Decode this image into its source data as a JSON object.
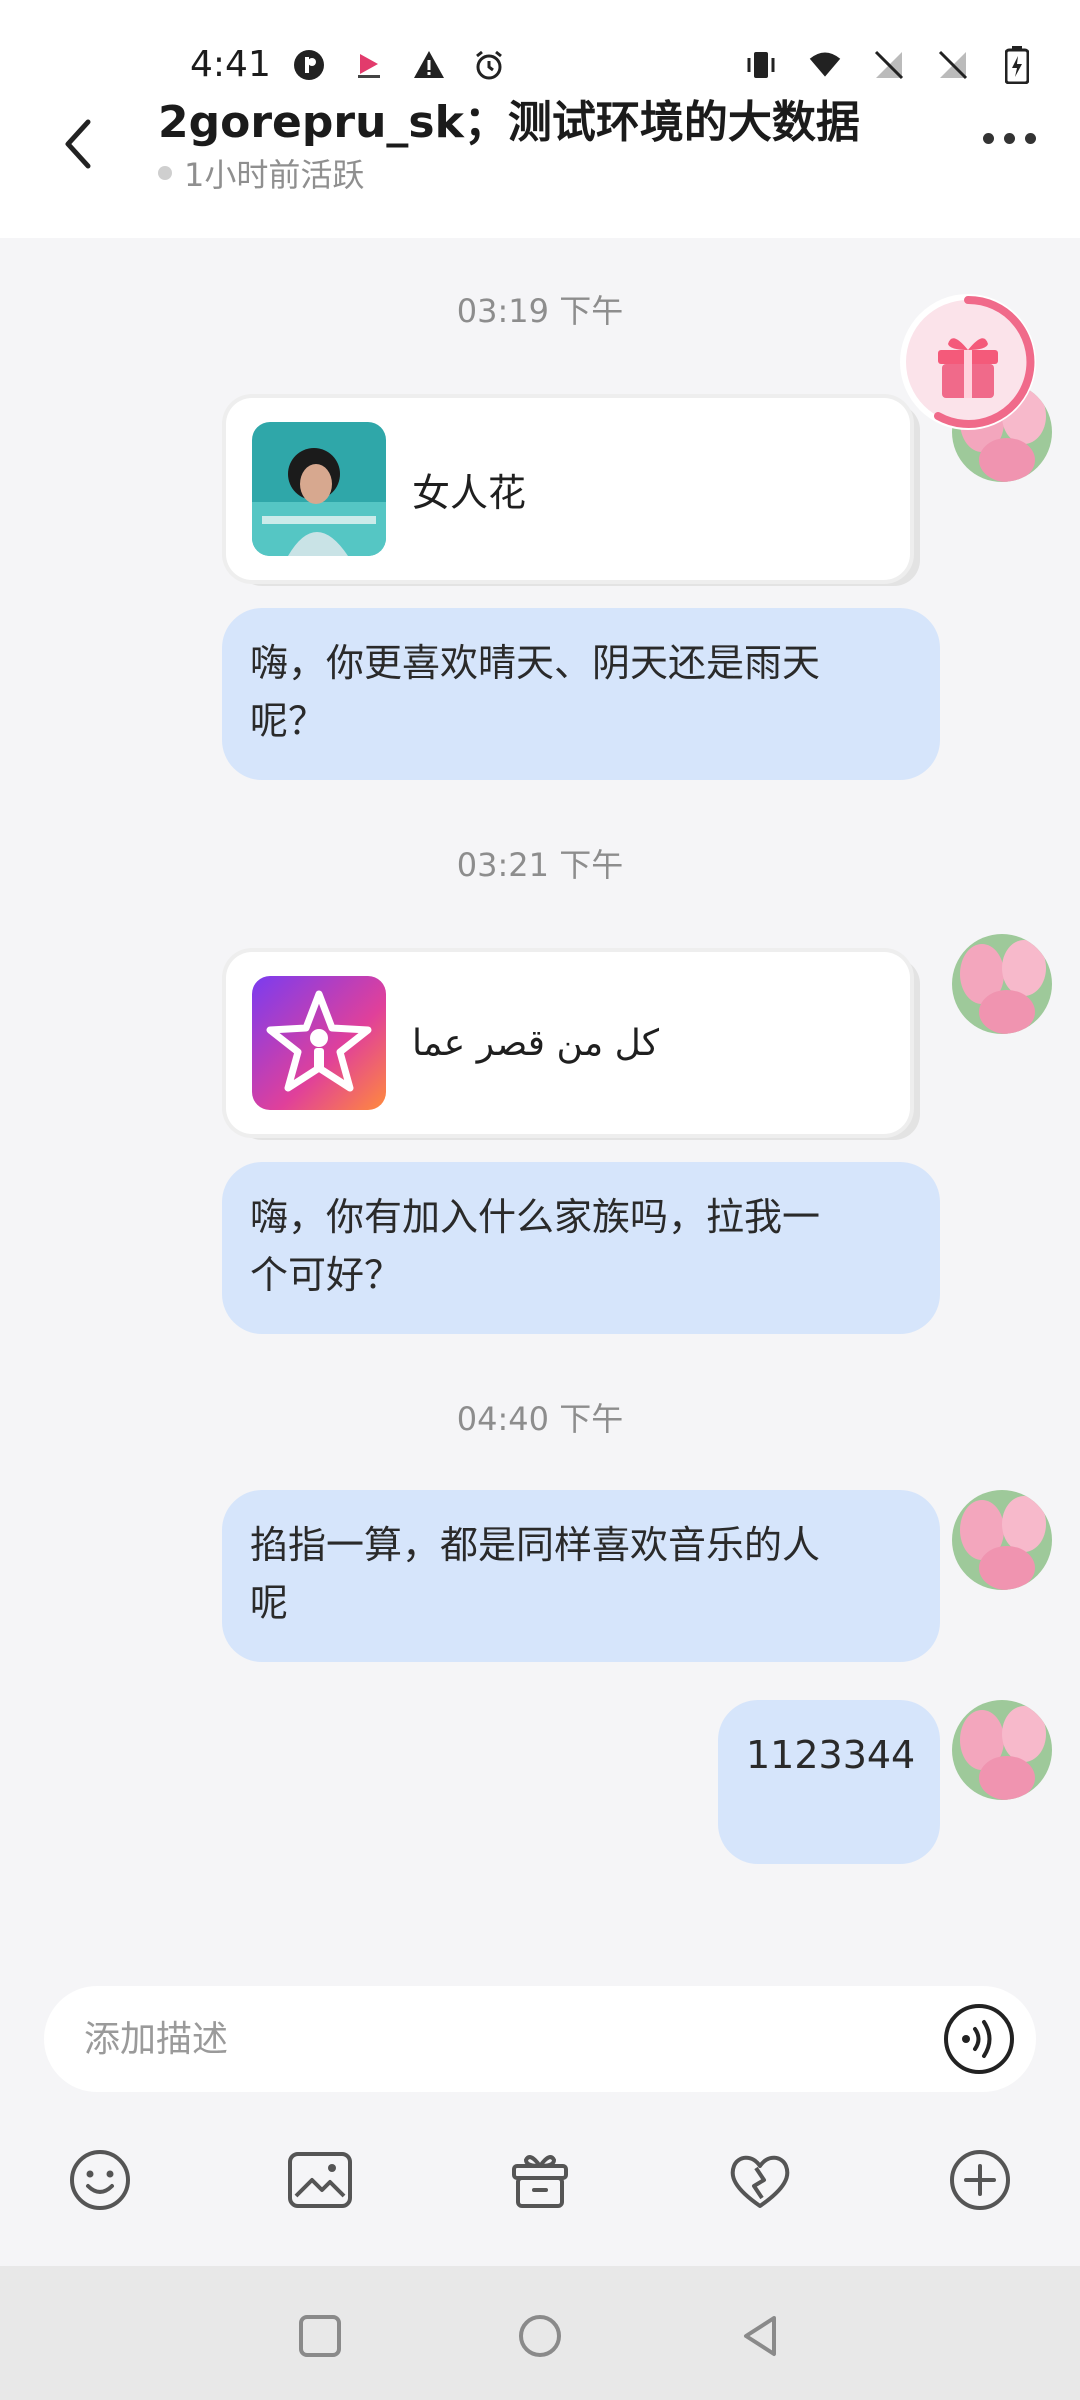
{
  "status_bar": {
    "time": "4:41"
  },
  "header": {
    "title": "2gorepru_sk；测试环境的大数据",
    "subtitle": "1小时前活跃"
  },
  "messages": [
    {
      "type": "timestamp",
      "text": "03:19 下午"
    },
    {
      "type": "card",
      "title": "女人花",
      "thumb": "album-cover"
    },
    {
      "type": "text",
      "text_lines": [
        "嗨，你更喜欢晴天、阴天还是雨天",
        "呢？"
      ]
    },
    {
      "type": "timestamp",
      "text": "03:21 下午"
    },
    {
      "type": "card",
      "title": "كل من قصر عما",
      "thumb": "starmaker-logo"
    },
    {
      "type": "text",
      "text_lines": [
        "嗨，你有加入什么家族吗，拉我一",
        "个可好？"
      ]
    },
    {
      "type": "timestamp",
      "text": "04:40 下午"
    },
    {
      "type": "text",
      "text_lines": [
        "掐指一算，都是同样喜欢音乐的人",
        "呢"
      ]
    },
    {
      "type": "text",
      "text_lines": [
        "1123344"
      ]
    }
  ],
  "composer": {
    "placeholder": "添加描述",
    "icons": [
      "voice-icon",
      "emoji-icon",
      "image-icon",
      "gift-icon",
      "heart-icon",
      "plus-icon"
    ]
  },
  "colors": {
    "bubble": "#d6e5fb",
    "background": "#f5f5f7",
    "gift_ring": "#f06a8a"
  }
}
